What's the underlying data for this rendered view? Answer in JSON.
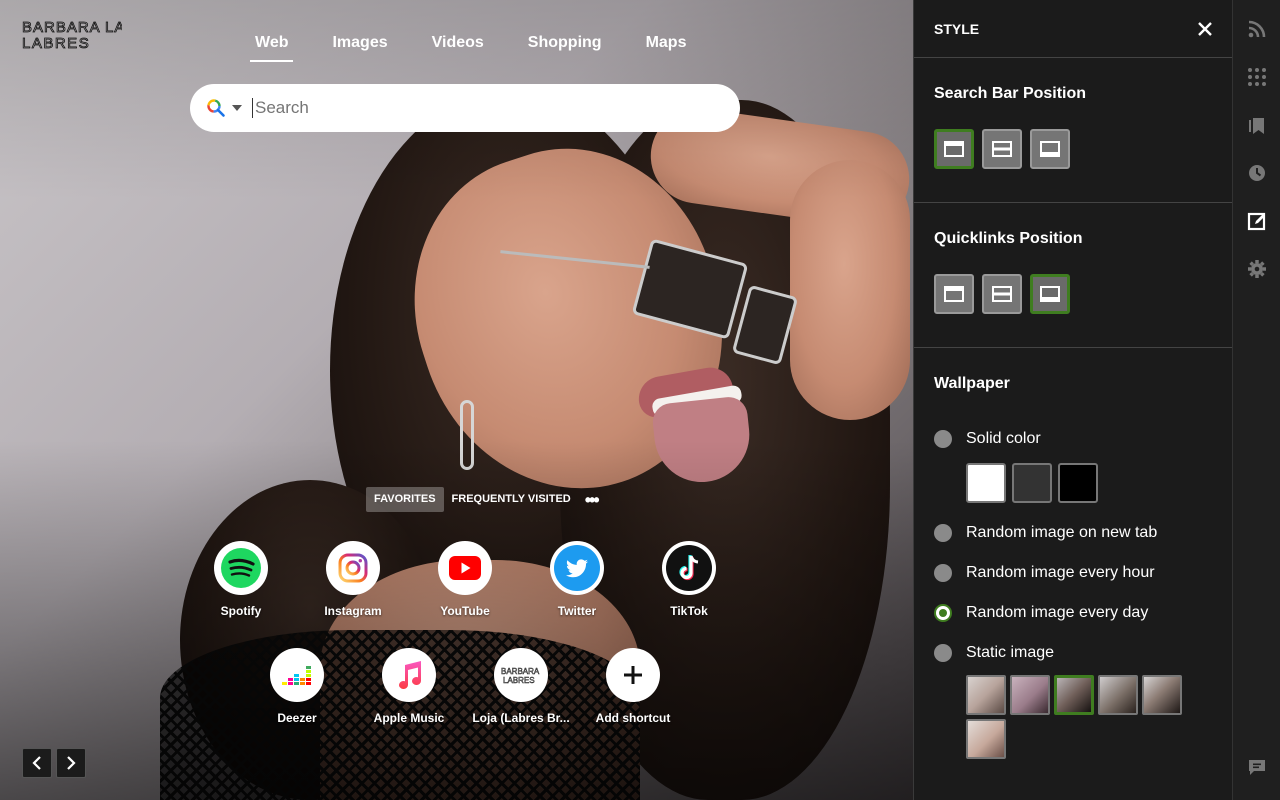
{
  "logo": {
    "text": "BARBARA LABRES"
  },
  "search_tabs": [
    {
      "label": "Web",
      "active": true
    },
    {
      "label": "Images",
      "active": false
    },
    {
      "label": "Videos",
      "active": false
    },
    {
      "label": "Shopping",
      "active": false
    },
    {
      "label": "Maps",
      "active": false
    }
  ],
  "search": {
    "placeholder": "Search",
    "engine_icon": "search-multicolor-icon"
  },
  "quicklinks_tabs": {
    "favorites": "FAVORITES",
    "frequently_visited": "FREQUENTLY VISITED",
    "more": "•••"
  },
  "quicklinks": [
    {
      "label": "Spotify",
      "icon": "spotify-icon"
    },
    {
      "label": "Instagram",
      "icon": "instagram-icon"
    },
    {
      "label": "YouTube",
      "icon": "youtube-icon"
    },
    {
      "label": "Twitter",
      "icon": "twitter-icon"
    },
    {
      "label": "TikTok",
      "icon": "tiktok-icon"
    },
    {
      "label": "Deezer",
      "icon": "deezer-icon"
    },
    {
      "label": "Apple Music",
      "icon": "apple-music-icon"
    },
    {
      "label": "Loja (Labres Br...",
      "icon": "labres-logo-icon"
    },
    {
      "label": "Add shortcut",
      "icon": "plus-icon"
    }
  ],
  "style_panel": {
    "title": "STYLE",
    "search_bar_position": {
      "title": "Search Bar Position",
      "selected": "top"
    },
    "quicklinks_position": {
      "title": "Quicklinks Position",
      "selected": "bottom"
    },
    "wallpaper": {
      "title": "Wallpaper",
      "options": [
        {
          "label": "Solid color",
          "checked": false
        },
        {
          "label": "Random image on new tab",
          "checked": false
        },
        {
          "label": "Random image every hour",
          "checked": false
        },
        {
          "label": "Random image every day",
          "checked": true
        },
        {
          "label": "Static image",
          "checked": false
        }
      ],
      "solid_colors": [
        "#ffffff",
        "#333333",
        "#000000"
      ],
      "thumbnail_count": 6,
      "selected_thumbnail": 3
    }
  },
  "colors": {
    "accent_green": "#3f7d20",
    "panel_bg": "#1c1c1c"
  }
}
